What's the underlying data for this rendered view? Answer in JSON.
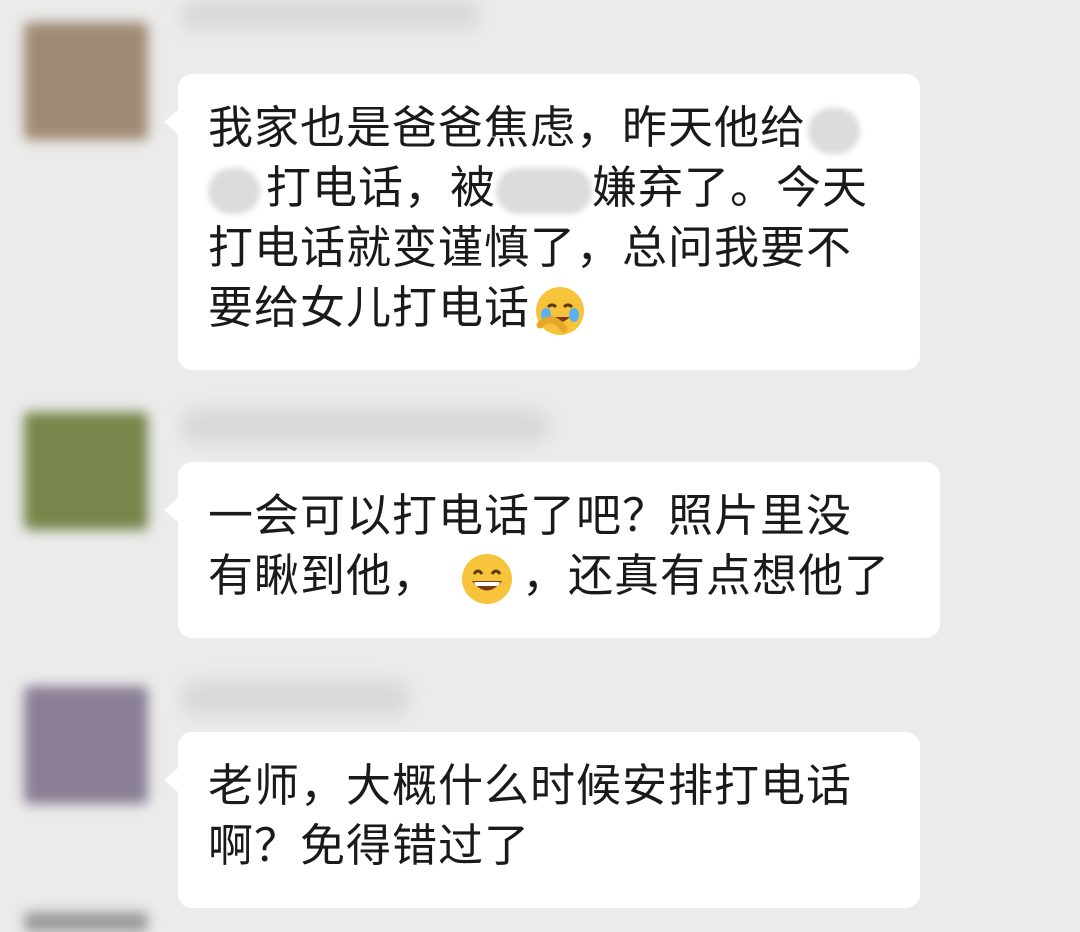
{
  "messages": [
    {
      "avatar_color": "#a08a73",
      "lines": [
        "我家也是爸爸焦虑，昨天他给",
        "打电话，被",
        "嫌弃了。今天",
        "打电话就变谨慎了，总问我要不",
        "要给女儿打电话"
      ],
      "emoji": "face-palm-laugh-icon"
    },
    {
      "avatar_color": "#77864a",
      "lines": [
        "一会可以打电话了吧？照片里没",
        "有瞅到他，",
        "，还真有点想他了"
      ],
      "emoji": "grinning-face-icon"
    },
    {
      "avatar_color": "#8a7f96",
      "lines": [
        "老师，大概什么时候安排打电话",
        "啊？免得错过了"
      ]
    }
  ],
  "colors": {
    "background": "#ebebeb",
    "bubble": "#ffffff",
    "text": "#1a1a1a",
    "emoji_yellow": "#f7c33a"
  }
}
